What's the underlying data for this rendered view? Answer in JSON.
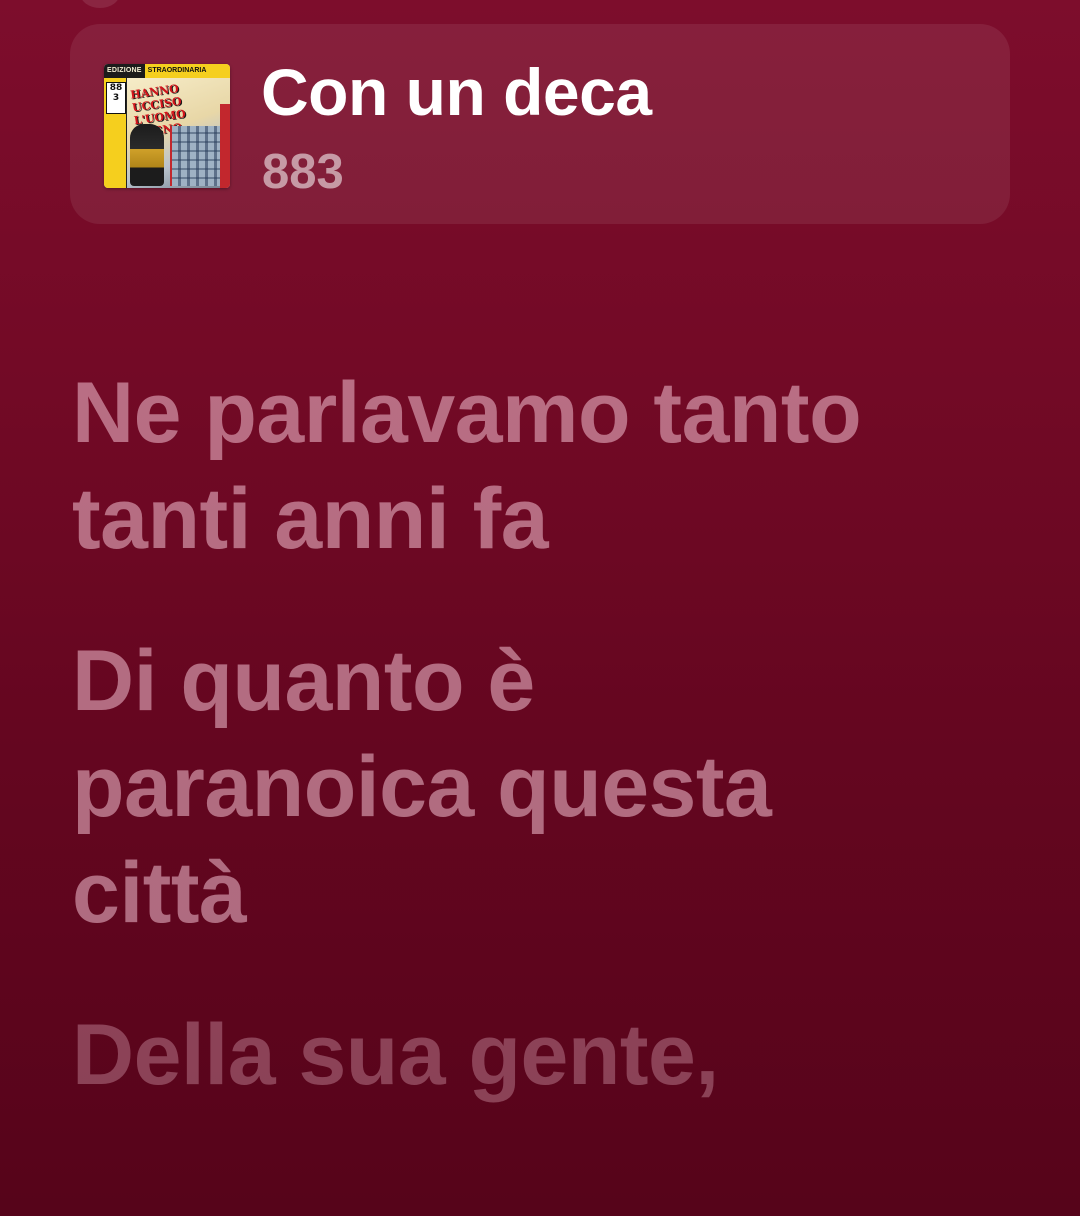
{
  "now_playing": {
    "title": "Con un deca",
    "artist": "883",
    "artwork": {
      "icon": "album-artwork",
      "header_left": "EDIZIONE",
      "header_right": "STRAORDINARIA",
      "badge": "883",
      "title_text": "HANNO UCCISO L'UOMO RAGNO"
    }
  },
  "lyrics": [
    {
      "text": "Ne parlavamo tanto\ntanti anni fa"
    },
    {
      "text": "Di quanto è\nparanoica questa\ncittà"
    },
    {
      "text": "Della sua gente,"
    }
  ],
  "colors": {
    "background_top": "#7d0d2c",
    "background_bottom": "#56041a",
    "title": "#ffffff",
    "artist": "rgba(255,255,255,0.55)",
    "lyric": "rgba(255,210,225,0.50)"
  }
}
